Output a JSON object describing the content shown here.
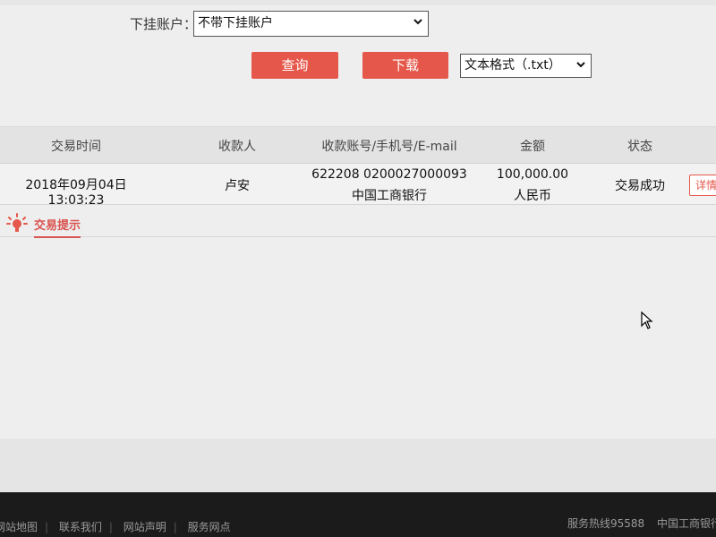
{
  "filter": {
    "label": "下挂账户：",
    "account_value": "不带下挂账户",
    "query_label": "查询",
    "download_label": "下载",
    "format_value": "文本格式（.txt）"
  },
  "table": {
    "headers": [
      "交易时间",
      "收款人",
      "收款账号/手机号/E-mail",
      "金额",
      "状态"
    ],
    "rows": [
      {
        "time": "2018年09月04日 13:03:23",
        "payee": "卢安",
        "account": "622208 0200027000093",
        "bank": "中国工商银行",
        "amount": "100,000.00",
        "currency": "人民币",
        "status": "交易成功",
        "detail_label": "详情"
      }
    ]
  },
  "tips": {
    "label": "交易提示"
  },
  "footer": {
    "links": [
      "网站地图",
      "联系我们",
      "网站声明",
      "服务网点"
    ],
    "hotline": "服务热线95588",
    "copyright": "中国工商银行版"
  },
  "colors": {
    "accent": "#e5574a",
    "footer_bg": "#1b1b1b"
  },
  "icons": {
    "tips": "lightbulb-icon",
    "select_caret": "chevron-down-icon",
    "cursor": "mouse-pointer-icon"
  }
}
